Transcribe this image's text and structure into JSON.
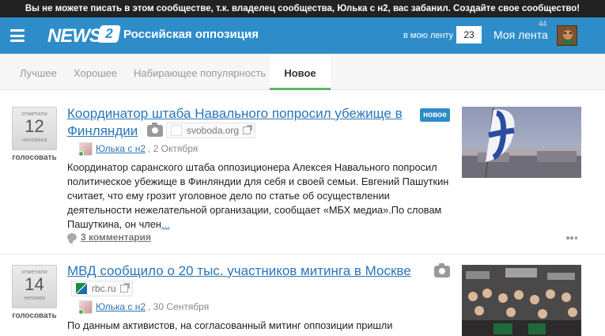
{
  "banner": {
    "text": "Вы не можете писать в этом сообществе, т.к. владелец сообщества, Юлька с н2, вас забанил. Создайте свое сообщество!"
  },
  "header": {
    "logo_text": "NEWS",
    "logo_badge": "2",
    "community_title": "Российская оппозиция",
    "feed_label": "в мою ленту",
    "feed_count": "23",
    "my_feed_label": "Моя лента",
    "my_feed_count": "44",
    "accent_color": "#2e8dc9"
  },
  "tabs": [
    {
      "label": "Лучшее",
      "active": false
    },
    {
      "label": "Хорошее",
      "active": false
    },
    {
      "label": "Набирающее популярность",
      "active": false
    },
    {
      "label": "Новое",
      "active": true
    }
  ],
  "posts": [
    {
      "vote_top": "отметили",
      "votes": "12",
      "vote_bottom": "человека",
      "vote_button": "голосовать",
      "title_line1": "Координатор штаба Навального попросил убежище в",
      "title_line2": "Финляндии",
      "badge": "новое",
      "source": "svoboda.org",
      "author": "Юлька с н2",
      "date": ", 2 Октября",
      "excerpt": "Координатор саранского штаба оппозиционера Алексея Навального попросил политическое убежище в Финляндии для себя и своей семьи. Евгений Пашуткин считает, что ему грозит уголовное дело по статье об осуществлении деятельности нежелательной организации, сообщает «МБХ медиа».По словам Пашуткина, он член",
      "more_link": "...",
      "comments": "3 комментария"
    },
    {
      "vote_top": "отметили",
      "votes": "14",
      "vote_bottom": "человек",
      "vote_button": "голосовать",
      "title_line1": "МВД сообщило о 20 тыс. участников митинга в Москве",
      "source": "rbc.ru",
      "author": "Юлька с н2",
      "date": ", 30 Сентября",
      "excerpt": "По данным активистов, на согласованный митинг оппозиции пришли"
    }
  ]
}
